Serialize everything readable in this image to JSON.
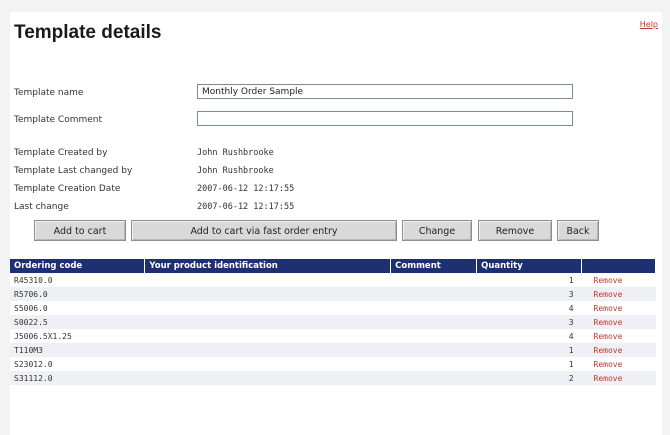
{
  "header": {
    "title": "Template details",
    "help_label": "Help"
  },
  "form": {
    "name_label": "Template name",
    "name_value": "Monthly Order Sample",
    "comment_label": "Template Comment",
    "comment_value": "",
    "created_by_label": "Template Created by",
    "created_by_value": "John Rushbrooke",
    "changed_by_label": "Template Last changed by",
    "changed_by_value": "John Rushbrooke",
    "creation_date_label": "Template Creation Date",
    "creation_date_value": "2007-06-12 12:17:55",
    "last_change_label": "Last change",
    "last_change_value": "2007-06-12 12:17:55"
  },
  "actions": {
    "add_to_cart": "Add to cart",
    "add_fast": "Add to cart via fast order entry",
    "change": "Change",
    "remove": "Remove",
    "back": "Back"
  },
  "table": {
    "headers": [
      "Ordering code",
      "Your product identification",
      "Comment",
      "Quantity",
      ""
    ],
    "remove_label": "Remove",
    "rows": [
      {
        "code": "R45310.0",
        "pid": "",
        "comment": "",
        "qty": "1"
      },
      {
        "code": "R5706.0",
        "pid": "",
        "comment": "",
        "qty": "3"
      },
      {
        "code": "S5006.0",
        "pid": "",
        "comment": "",
        "qty": "4"
      },
      {
        "code": "S0022.5",
        "pid": "",
        "comment": "",
        "qty": "3"
      },
      {
        "code": "J5006.5X1.25",
        "pid": "",
        "comment": "",
        "qty": "4"
      },
      {
        "code": "T110M3",
        "pid": "",
        "comment": "",
        "qty": "1"
      },
      {
        "code": "S23012.0",
        "pid": "",
        "comment": "",
        "qty": "1"
      },
      {
        "code": "S31112.0",
        "pid": "",
        "comment": "",
        "qty": "2"
      }
    ]
  },
  "colors": {
    "header_bg": "#1f2f73",
    "remove_link": "#c0392b"
  }
}
